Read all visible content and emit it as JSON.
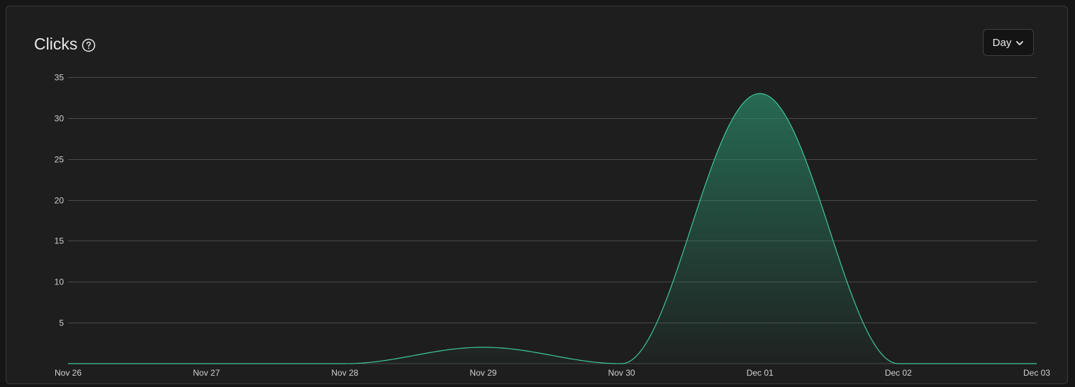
{
  "header": {
    "title": "Clicks",
    "help_icon": "help-circle-icon"
  },
  "period_select": {
    "selected": "Day",
    "icon": "chevron-down-icon"
  },
  "colors": {
    "line": "#3fc79b",
    "fill": "#2a8a6b",
    "grid": "#4a4a4a",
    "background": "#1e1e1e"
  },
  "chart_data": {
    "type": "area",
    "x": [
      "Nov 26",
      "Nov 27",
      "Nov 28",
      "Nov 29",
      "Nov 30",
      "Dec 01",
      "Dec 02",
      "Dec 03"
    ],
    "series": [
      {
        "values": [
          0,
          0,
          0,
          2,
          0,
          33,
          0,
          0
        ]
      }
    ],
    "y_ticks": [
      5,
      10,
      15,
      20,
      25,
      30,
      35
    ],
    "ylim": [
      0,
      35
    ],
    "grid": true,
    "smooth": true
  }
}
